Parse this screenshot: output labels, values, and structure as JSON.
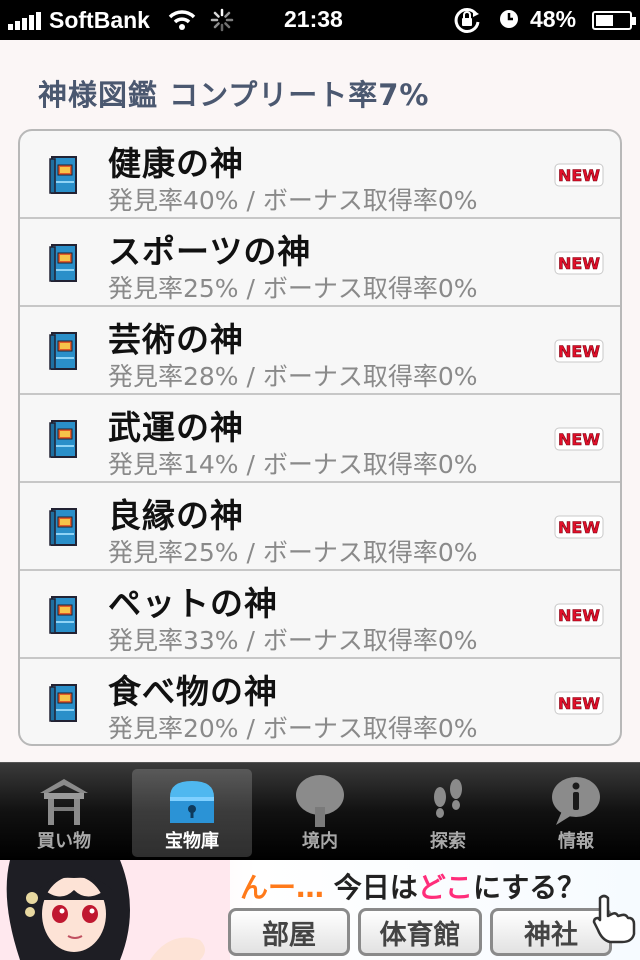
{
  "status_bar": {
    "carrier": "SoftBank",
    "time": "21:38",
    "battery": "48%",
    "battery_level": 0.48
  },
  "page": {
    "title": "神様図鑑  コンプリート率7%"
  },
  "items": [
    {
      "title": "健康の神",
      "subtitle": "発見率40% / ボーナス取得率0%",
      "badge": "NEW"
    },
    {
      "title": "スポーツの神",
      "subtitle": "発見率25% / ボーナス取得率0%",
      "badge": "NEW"
    },
    {
      "title": "芸術の神",
      "subtitle": "発見率28% / ボーナス取得率0%",
      "badge": "NEW"
    },
    {
      "title": "武運の神",
      "subtitle": "発見率14% / ボーナス取得率0%",
      "badge": "NEW"
    },
    {
      "title": "良縁の神",
      "subtitle": "発見率25% / ボーナス取得率0%",
      "badge": "NEW"
    },
    {
      "title": "ペットの神",
      "subtitle": "発見率33% / ボーナス取得率0%",
      "badge": "NEW"
    },
    {
      "title": "食べ物の神",
      "subtitle": "発見率20% / ボーナス取得率0%",
      "badge": "NEW"
    }
  ],
  "tabs": [
    {
      "label": "買い物",
      "icon": "shrine-roof-icon",
      "active": false
    },
    {
      "label": "宝物庫",
      "icon": "treasure-chest-icon",
      "active": true
    },
    {
      "label": "境内",
      "icon": "tree-icon",
      "active": false
    },
    {
      "label": "探索",
      "icon": "footprints-icon",
      "active": false
    },
    {
      "label": "情報",
      "icon": "info-bubble-icon",
      "active": false
    }
  ],
  "banner": {
    "prompt_part1": "んー…",
    "prompt_part2": "今日は",
    "prompt_part3": "どこ",
    "prompt_part4": "にする？",
    "buttons": [
      "部屋",
      "体育館",
      "神社"
    ]
  },
  "colors": {
    "title": "#4b5870",
    "badge_red": "#e0102a",
    "tab_active_icon": "#3aa6e6"
  }
}
